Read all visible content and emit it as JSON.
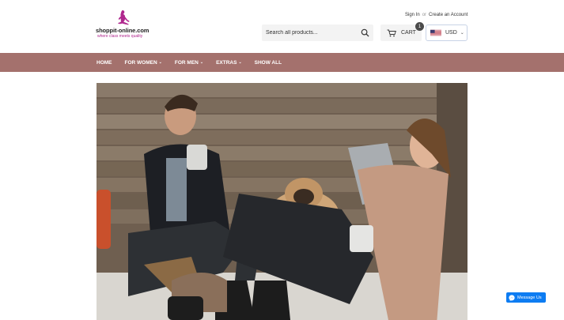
{
  "brand": {
    "name": "shoppit-online.com",
    "tagline": "where class meets quality"
  },
  "account": {
    "sign_in": "Sign In",
    "or": "or",
    "create_account": "Create an Account"
  },
  "search": {
    "placeholder": "Search all products...",
    "icon": "search-icon"
  },
  "cart": {
    "label": "CART",
    "count": "1",
    "icon": "cart-icon"
  },
  "currency": {
    "selected": "USD",
    "flag": "us-flag-icon"
  },
  "nav": {
    "items": [
      {
        "label": "HOME",
        "has_dropdown": false
      },
      {
        "label": "FOR WOMEN",
        "has_dropdown": true
      },
      {
        "label": "FOR MEN",
        "has_dropdown": true
      },
      {
        "label": "EXTRAS",
        "has_dropdown": true
      },
      {
        "label": "SHOW ALL",
        "has_dropdown": false
      }
    ]
  },
  "hero": {
    "image": "couple-with-pug-on-bench-photo"
  },
  "chat": {
    "label": "Message Us",
    "icon": "messenger-icon"
  },
  "colors": {
    "nav_bg": "#a4716d",
    "brand_accent": "#b0288e",
    "messenger_blue": "#0d7cf2"
  }
}
